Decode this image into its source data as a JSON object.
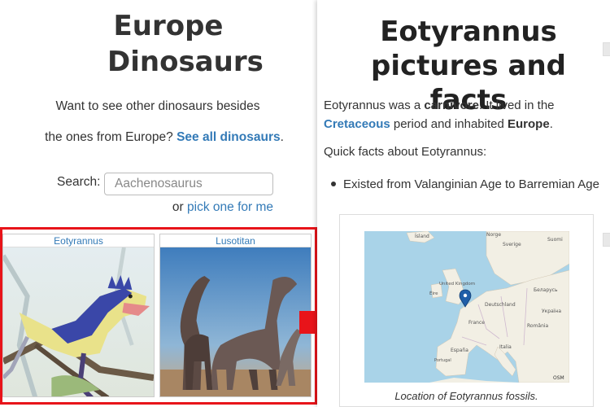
{
  "left": {
    "title": "Europe Dinosaurs",
    "intro_line1": "Want to see other dinosaurs besides",
    "intro_line2_prefix": "the ones from Europe?",
    "intro_link": "See all dinosaurs",
    "intro_suffix": ".",
    "search_label": "Search:",
    "search_placeholder": "Aachenosaurus",
    "pick_prefix": "or",
    "pick_link": "pick one for me",
    "cards": [
      {
        "title": "Eotyrannus"
      },
      {
        "title": "Lusotitan"
      }
    ]
  },
  "right": {
    "title": "Eotyrannus pictures and facts",
    "para_1": "Eotyrannus was a",
    "diet": "carnivore",
    "para_2": ". It lived in the",
    "period": "Cretaceous",
    "para_3": "period and inhabited",
    "region": "Europe",
    "para_4": ".",
    "quick_facts": "Quick facts about Eotyrannus:",
    "bullet": "Existed from Valanginian Age to Barremian Age",
    "map_labels": {
      "island": "Ísland",
      "norge": "Norge",
      "sverige": "Sverige",
      "suomi": "Suomi",
      "uk": "United Kingdom",
      "eire": "Éire",
      "deutschland": "Deutschland",
      "belarus": "Беларусь",
      "ukraina": "Україна",
      "france": "France",
      "romania": "România",
      "espana": "España",
      "italia": "Italia",
      "portugal": "Portugal",
      "osm": "OSM"
    },
    "caption": "Location of Eotyrannus fossils."
  },
  "colors": {
    "link": "#337ab7",
    "highlight": "#e8141a",
    "arrow": "#e8141a",
    "map_water": "#a9d3e8",
    "map_land": "#f2efe4",
    "marker": "#1f5ea8"
  },
  "icons": {
    "arrow": "red-right-arrow-icon",
    "marker": "map-pin-icon"
  }
}
